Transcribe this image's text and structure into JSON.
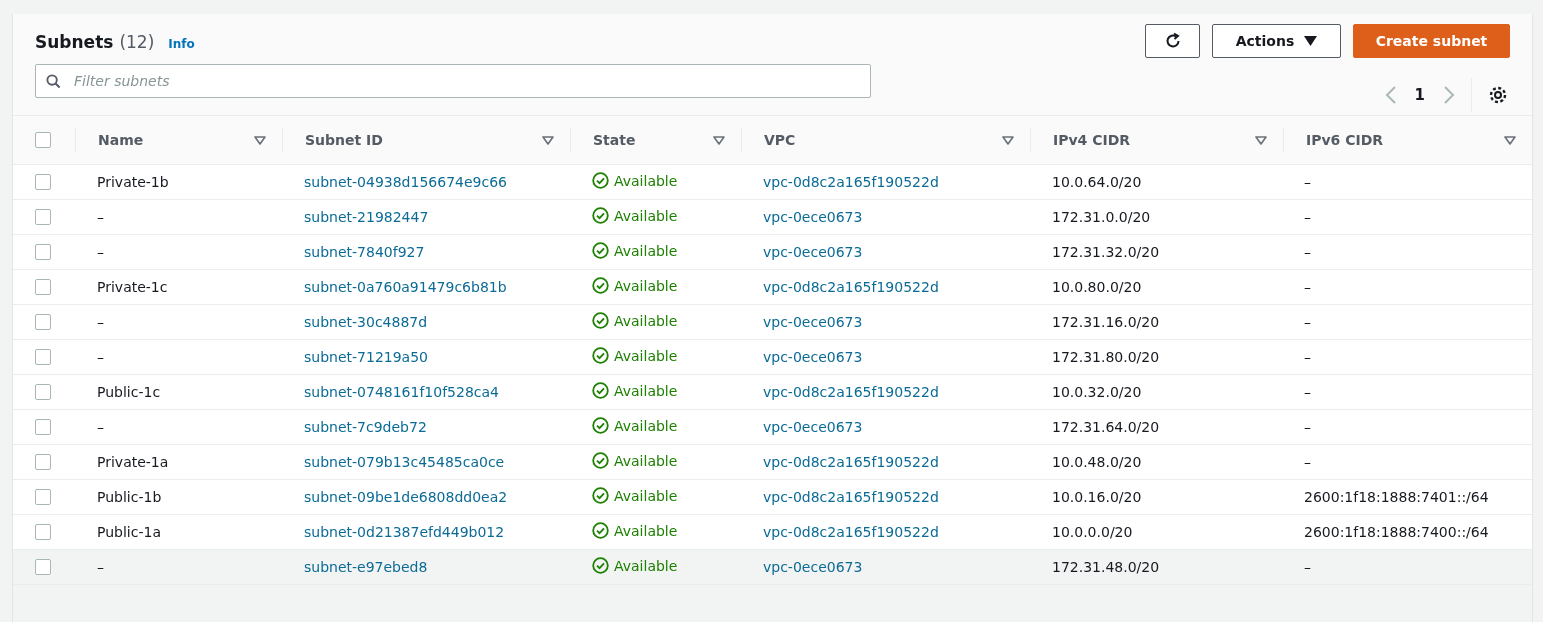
{
  "header": {
    "title": "Subnets",
    "count": "(12)",
    "info": "Info"
  },
  "buttons": {
    "actions": "Actions",
    "create": "Create subnet"
  },
  "search": {
    "placeholder": "Filter subnets"
  },
  "pagination": {
    "page": "1"
  },
  "table": {
    "columns": [
      "Name",
      "Subnet ID",
      "State",
      "VPC",
      "IPv4 CIDR",
      "IPv6 CIDR"
    ],
    "all_checked": false,
    "rows": [
      {
        "checked": false,
        "name": "Private-1b",
        "subnet_id": "subnet-04938d156674e9c66",
        "state": "Available",
        "kind": "available",
        "vpc": "vpc-0d8c2a165f190522d",
        "ipv4": "10.0.64.0/20",
        "ipv6": "–"
      },
      {
        "checked": false,
        "name": "–",
        "subnet_id": "subnet-21982447",
        "state": "Available",
        "kind": "available",
        "vpc": "vpc-0ece0673",
        "ipv4": "172.31.0.0/20",
        "ipv6": "–"
      },
      {
        "checked": false,
        "name": "–",
        "subnet_id": "subnet-7840f927",
        "state": "Available",
        "kind": "available",
        "vpc": "vpc-0ece0673",
        "ipv4": "172.31.32.0/20",
        "ipv6": "–"
      },
      {
        "checked": false,
        "name": "Private-1c",
        "subnet_id": "subnet-0a760a91479c6b81b",
        "state": "Available",
        "kind": "available",
        "vpc": "vpc-0d8c2a165f190522d",
        "ipv4": "10.0.80.0/20",
        "ipv6": "–"
      },
      {
        "checked": false,
        "name": "–",
        "subnet_id": "subnet-30c4887d",
        "state": "Available",
        "kind": "available",
        "vpc": "vpc-0ece0673",
        "ipv4": "172.31.16.0/20",
        "ipv6": "–"
      },
      {
        "checked": false,
        "name": "–",
        "subnet_id": "subnet-71219a50",
        "state": "Available",
        "kind": "available",
        "vpc": "vpc-0ece0673",
        "ipv4": "172.31.80.0/20",
        "ipv6": "–"
      },
      {
        "checked": false,
        "name": "Public-1c",
        "subnet_id": "subnet-0748161f10f528ca4",
        "state": "Available",
        "kind": "available",
        "vpc": "vpc-0d8c2a165f190522d",
        "ipv4": "10.0.32.0/20",
        "ipv6": "–"
      },
      {
        "checked": false,
        "name": "–",
        "subnet_id": "subnet-7c9deb72",
        "state": "Available",
        "kind": "available",
        "vpc": "vpc-0ece0673",
        "ipv4": "172.31.64.0/20",
        "ipv6": "–"
      },
      {
        "checked": false,
        "name": "Private-1a",
        "subnet_id": "subnet-079b13c45485ca0ce",
        "state": "Available",
        "kind": "available",
        "vpc": "vpc-0d8c2a165f190522d",
        "ipv4": "10.0.48.0/20",
        "ipv6": "–"
      },
      {
        "checked": false,
        "name": "Public-1b",
        "subnet_id": "subnet-09be1de6808dd0ea2",
        "state": "Available",
        "kind": "available",
        "vpc": "vpc-0d8c2a165f190522d",
        "ipv4": "10.0.16.0/20",
        "ipv6": "2600:1f18:1888:7401::/64"
      },
      {
        "checked": false,
        "name": "Public-1a",
        "subnet_id": "subnet-0d21387efd449b012",
        "state": "Available",
        "kind": "available",
        "vpc": "vpc-0d8c2a165f190522d",
        "ipv4": "10.0.0.0/20",
        "ipv6": "2600:1f18:1888:7400::/64"
      },
      {
        "checked": false,
        "name": "–",
        "subnet_id": "subnet-e97ebed8",
        "state": "Available",
        "kind": "available",
        "vpc": "vpc-0ece0673",
        "ipv4": "172.31.48.0/20",
        "ipv6": "–"
      }
    ]
  }
}
